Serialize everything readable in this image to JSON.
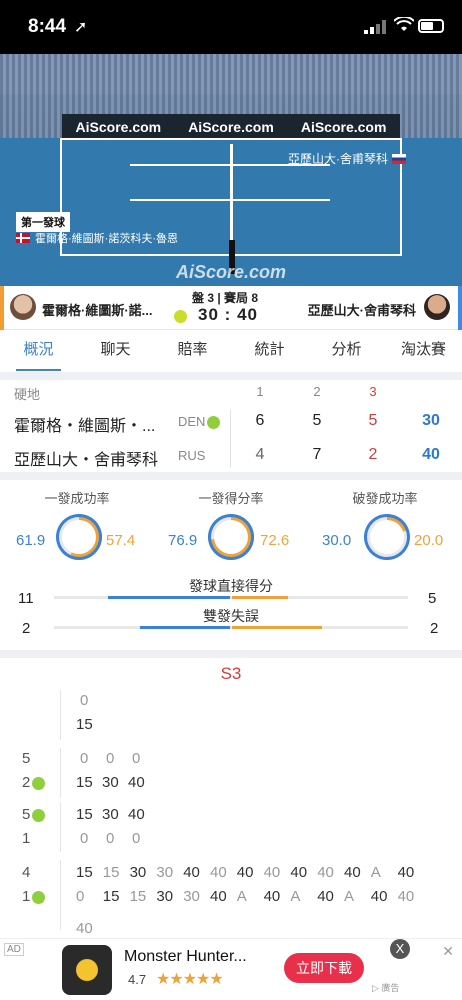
{
  "status_bar": {
    "time": "8:44",
    "location_icon": "➚"
  },
  "court": {
    "banners": [
      "AiScore.com",
      "AiScore.com",
      "AiScore.com"
    ],
    "top_player": "亞歷山大·舍甫琴科",
    "first_serve": "第一發球",
    "bottom_player": "霍爾格·維圖斯·諾茨科夫·魯恩",
    "watermark": "AiScore.com"
  },
  "scorebar": {
    "left_player": "霍爾格·維圖斯·諾...",
    "right_player": "亞歷山大·舍甫琴科",
    "set_game": "盤 3 | 賽局 8",
    "score_left": "30",
    "score_sep": ":",
    "score_right": "40"
  },
  "tabs": [
    "概況",
    "聊天",
    "賠率",
    "統計",
    "分析",
    "淘汰賽"
  ],
  "score_table": {
    "surface": "硬地",
    "sets": [
      "1",
      "2",
      "3"
    ],
    "rows": [
      {
        "name": "霍爾格・維圖斯・...",
        "country": "DEN",
        "sets": [
          "6",
          "5",
          "5"
        ],
        "total": "30"
      },
      {
        "name": "亞歷山大・舍甫琴科",
        "country": "RUS",
        "sets": [
          "4",
          "7",
          "2"
        ],
        "total": "40"
      }
    ]
  },
  "stats": {
    "circles": [
      {
        "title": "一發成功率",
        "left": "61.9",
        "right": "57.4"
      },
      {
        "title": "一發得分率",
        "left": "76.9",
        "right": "72.6"
      },
      {
        "title": "破發成功率",
        "left": "30.0",
        "right": "20.0"
      }
    ],
    "bars": [
      {
        "title": "發球直接得分",
        "left": "11",
        "right": "5"
      },
      {
        "title": "雙發失誤",
        "left": "2",
        "right": "2"
      }
    ]
  },
  "pbp": {
    "set_label": "S3",
    "g0": {
      "top": "0",
      "bottom": "15"
    },
    "g1": {
      "a": "5",
      "b": "2",
      "top": [
        "0",
        "0",
        "0"
      ],
      "bottom": [
        "15",
        "30",
        "40"
      ]
    },
    "g2": {
      "a": "5",
      "b": "1",
      "top": [
        "15",
        "30",
        "40"
      ],
      "bottom": [
        "0",
        "0",
        "0"
      ]
    },
    "g3": {
      "a": "4",
      "b": "1",
      "top": [
        "15",
        "15",
        "30",
        "30",
        "40",
        "40",
        "40",
        "40",
        "40",
        "40",
        "40",
        "A",
        "40"
      ],
      "bottom": [
        "0",
        "15",
        "15",
        "30",
        "30",
        "40",
        "A",
        "40",
        "A",
        "40",
        "A",
        "40",
        "40"
      ],
      "extra": "40"
    }
  },
  "ad": {
    "tag": "AD",
    "title": "Monster Hunter...",
    "rating": "4.7",
    "stars": "★★★★★",
    "button": "立即下載",
    "close": "X",
    "dismiss": "✕",
    "adchoices": "▷ 廣告"
  }
}
